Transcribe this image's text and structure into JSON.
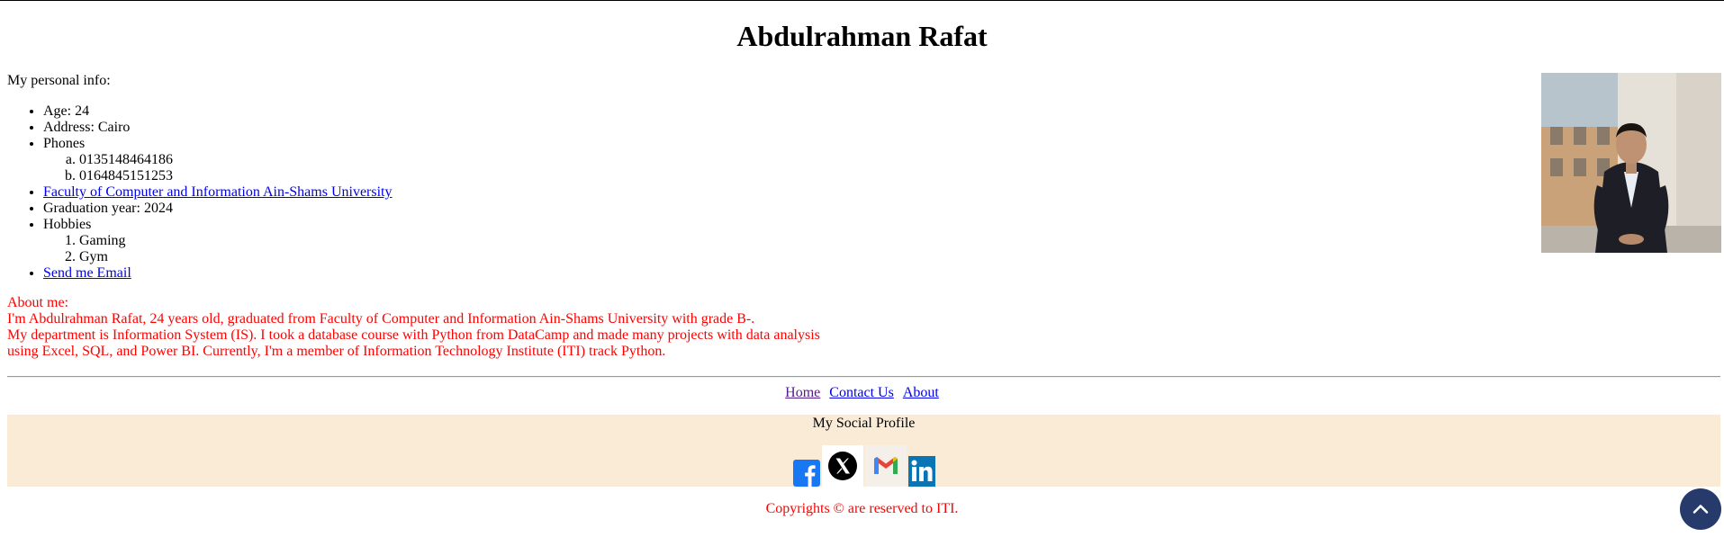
{
  "page": {
    "title": "Abdulrahman Rafat"
  },
  "personal_info": {
    "heading": "My personal info:",
    "age": "Age: 24",
    "address": "Address: Cairo",
    "phones_label": "Phones",
    "phones": [
      "0135148464186",
      "0164845151253"
    ],
    "faculty_link": "Faculty of Computer and Information Ain-Shams University",
    "graduation": "Graduation year: 2024",
    "hobbies_label": "Hobbies",
    "hobbies": [
      "Gaming",
      "Gym"
    ],
    "email_link": "Send me Email"
  },
  "about": {
    "heading": "About me:",
    "line1": "I'm Abdulrahman Rafat, 24 years old, graduated from Faculty of Computer and Information Ain-Shams University with grade B-.",
    "line2": "My department is Information System (IS). I took a database course with Python from DataCamp and made many projects with data analysis using Excel, SQL, and Power BI. Currently, I'm a member of Information Technology Institute (ITI) track Python."
  },
  "nav": {
    "home": "Home",
    "contact": "Contact Us",
    "about": "About"
  },
  "social": {
    "title": "My Social Profile",
    "icons": [
      "facebook-icon",
      "x-twitter-icon",
      "gmail-icon",
      "linkedin-icon"
    ]
  },
  "footer": {
    "copyright": "Copyrights © are reserved to ITI."
  },
  "colors": {
    "about_text": "#ff0000",
    "social_bg": "#faebd7",
    "link": "#0000ee",
    "visited_link": "#551a8b",
    "scroll_button": "#263a6b"
  }
}
